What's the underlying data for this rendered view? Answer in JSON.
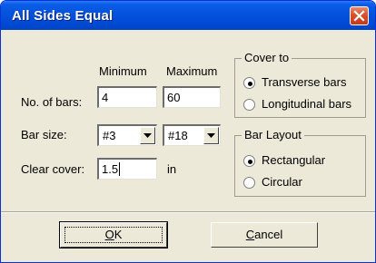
{
  "window": {
    "title": "All Sides Equal"
  },
  "columns": {
    "minimum": "Minimum",
    "maximum": "Maximum"
  },
  "fields": {
    "no_of_bars_label": "No. of bars:",
    "no_of_bars_min": "4",
    "no_of_bars_max": "60",
    "bar_size_label": "Bar size:",
    "bar_size_min": "#3",
    "bar_size_max": "#18",
    "clear_cover_label": "Clear cover:",
    "clear_cover_value": "1.5",
    "clear_cover_unit": "in"
  },
  "cover_to": {
    "title": "Cover to",
    "options": [
      {
        "label": "Transverse bars",
        "selected": true
      },
      {
        "label": "Longitudinal bars",
        "selected": false
      }
    ]
  },
  "bar_layout": {
    "title": "Bar Layout",
    "options": [
      {
        "label": "Rectangular",
        "selected": true
      },
      {
        "label": "Circular",
        "selected": false
      }
    ]
  },
  "buttons": {
    "ok_mnemonic": "O",
    "ok_rest": "K",
    "cancel_mnemonic": "C",
    "cancel_rest": "ancel"
  },
  "icons": {
    "close": "close-icon",
    "dropdown": "chevron-down-icon"
  },
  "colors": {
    "titlebar": "#0453dd",
    "close_button": "#d8502d",
    "dialog_bg": "#ece9d8"
  }
}
